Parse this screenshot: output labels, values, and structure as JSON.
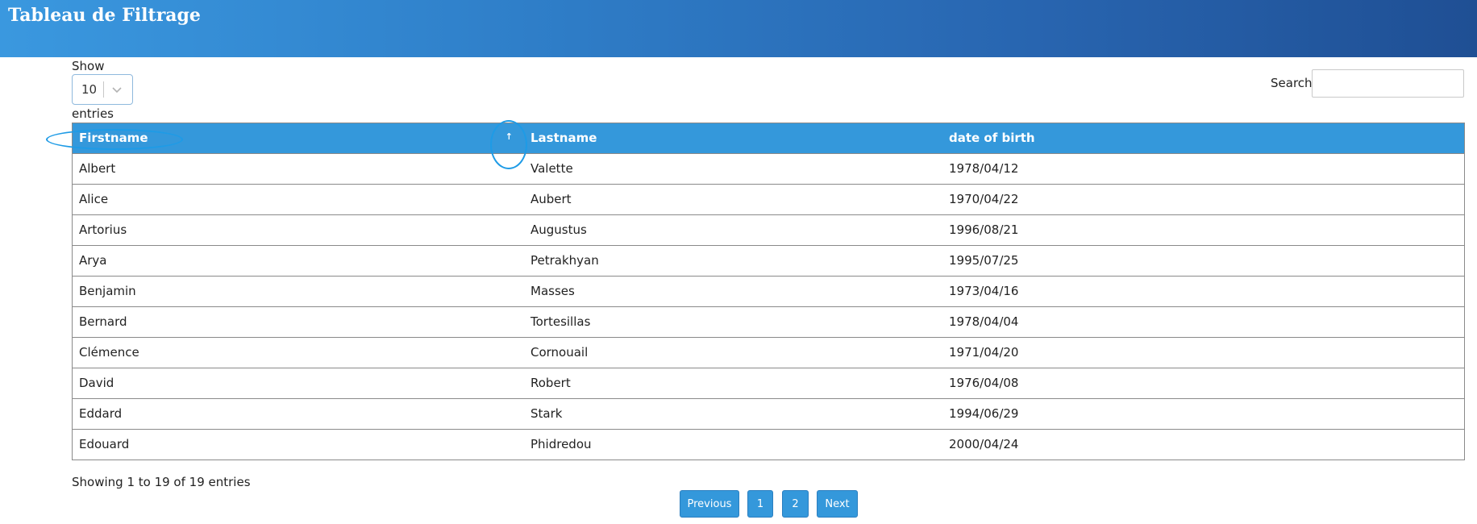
{
  "header": {
    "title": "Tableau de Filtrage"
  },
  "length_menu": {
    "show_label": "Show",
    "selected": "10",
    "entries_label": "entries"
  },
  "search": {
    "label": "Search:",
    "value": "",
    "placeholder": ""
  },
  "table": {
    "columns": [
      "Firstname",
      "Lastname",
      "date of birth"
    ],
    "sort_indicator": "↑",
    "rows": [
      [
        "Albert",
        "Valette",
        "1978/04/12"
      ],
      [
        "Alice",
        "Aubert",
        "1970/04/22"
      ],
      [
        "Artorius",
        "Augustus",
        "1996/08/21"
      ],
      [
        "Arya",
        "Petrakhyan",
        "1995/07/25"
      ],
      [
        "Benjamin",
        "Masses",
        "1973/04/16"
      ],
      [
        "Bernard",
        "Tortesillas",
        "1978/04/04"
      ],
      [
        "Clémence",
        "Cornouail",
        "1971/04/20"
      ],
      [
        "David",
        "Robert",
        "1976/04/08"
      ],
      [
        "Eddard",
        "Stark",
        "1994/06/29"
      ],
      [
        "Edouard",
        "Phidredou",
        "2000/04/24"
      ]
    ]
  },
  "info": "Showing 1 to 19 of 19 entries",
  "pagination": {
    "previous": "Previous",
    "pages": [
      "1",
      "2"
    ],
    "next": "Next"
  },
  "colors": {
    "accent": "#3498db",
    "header_start": "#3a98df",
    "header_end": "#1f4f94",
    "annotation": "#1e9be6"
  }
}
